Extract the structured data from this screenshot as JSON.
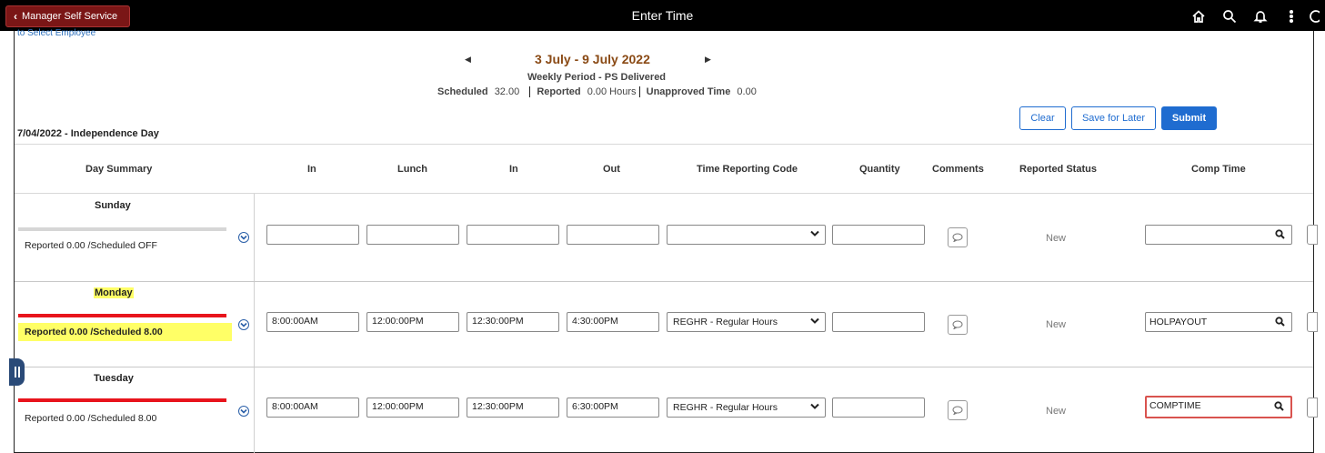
{
  "header": {
    "back_label": "Manager Self Service",
    "title": "Enter Time",
    "icons": [
      "home-icon",
      "search-icon",
      "bell-icon",
      "more-icon",
      "nav-icon"
    ]
  },
  "select_employee_label": "to Select Employee",
  "period": {
    "date_range": "3 July - 9 July 2022",
    "period_name": "Weekly Period - PS Delivered",
    "scheduled_label": "Scheduled",
    "scheduled_value": "32.00",
    "reported_label": "Reported",
    "reported_value": "0.00 Hours",
    "unapproved_label": "Unapproved Time",
    "unapproved_value": "0.00"
  },
  "holiday_note": "7/04/2022 - Independence Day",
  "buttons": {
    "clear": "Clear",
    "save_for_later": "Save for Later",
    "submit": "Submit"
  },
  "columns": {
    "day_summary": "Day Summary",
    "in1": "In",
    "lunch": "Lunch",
    "in2": "In",
    "out": "Out",
    "trc": "Time Reporting Code",
    "quantity": "Quantity",
    "comments": "Comments",
    "reported_status": "Reported Status",
    "comp_time": "Comp Time"
  },
  "rows": [
    {
      "day": "Sunday",
      "summary": "Reported 0.00 /Scheduled OFF",
      "bar_color": "#d6d6d6",
      "highlighted": false,
      "in1": "",
      "lunch": "",
      "in2": "",
      "out": "",
      "trc": "",
      "quantity": "",
      "status": "New",
      "comp_time": ""
    },
    {
      "day": "Monday",
      "summary": "Reported 0.00 /Scheduled 8.00",
      "bar_color": "#e8141c",
      "highlighted": true,
      "in1": "8:00:00AM",
      "lunch": "12:00:00PM",
      "in2": "12:30:00PM",
      "out": "4:30:00PM",
      "trc": "REGHR - Regular Hours",
      "quantity": "",
      "status": "New",
      "comp_time": "HOLPAYOUT"
    },
    {
      "day": "Tuesday",
      "summary": "Reported 0.00 /Scheduled 8.00",
      "bar_color": "#e8141c",
      "highlighted": false,
      "in1": "8:00:00AM",
      "lunch": "12:00:00PM",
      "in2": "12:30:00PM",
      "out": "6:30:00PM",
      "trc": "REGHR - Regular Hours",
      "quantity": "",
      "status": "New",
      "comp_time": "COMPTIME"
    }
  ]
}
